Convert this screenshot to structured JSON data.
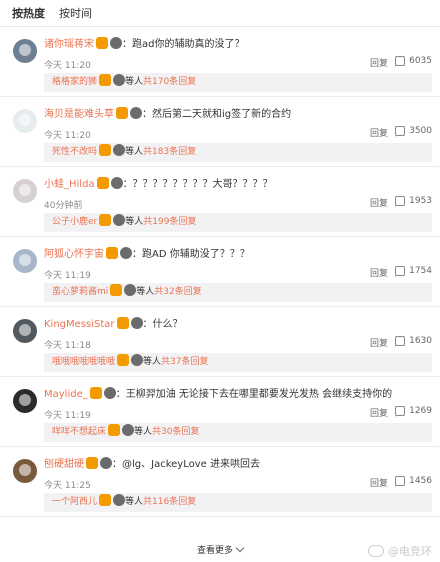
{
  "tabs": [
    {
      "label": "按热度"
    },
    {
      "label": "按时间"
    }
  ],
  "comments": [
    {
      "user": "诸你瑶蒋宋",
      "text": "：跑ad你的辅助真的没了？",
      "time": "今天 11:20",
      "reply": "回复",
      "likes": "6035",
      "sub_user": "格格家的狮",
      "sub_suffix": "等人",
      "sub_more": "共170条回复"
    },
    {
      "user": "海贝是能难头草",
      "text": "：然后第二天就和ig签了新的合约",
      "time": "今天 11:20",
      "reply": "回复",
      "likes": "3500",
      "sub_user": "死性不改吗",
      "sub_suffix": "等人",
      "sub_more": "共183条回复"
    },
    {
      "user": "小蛙_Hilda",
      "text": "：？？？？？？？？大哥？？？？",
      "time": "40分钟前",
      "reply": "回复",
      "likes": "1953",
      "sub_user": "公子小鹿er",
      "sub_suffix": "等人",
      "sub_more": "共199条回复"
    },
    {
      "user": "阿狐心怀宇宙",
      "text": "：跑AD 你辅助没了？？？",
      "time": "今天 11:19",
      "reply": "回复",
      "likes": "1754",
      "sub_user": "蛮心萝莉酱mi",
      "sub_suffix": "等人",
      "sub_more": "共32条回复"
    },
    {
      "user": "KingMessiStar",
      "text": "：什么？",
      "time": "今天 11:18",
      "reply": "回复",
      "likes": "1630",
      "sub_user": "哦哦哦哦哦哦哦",
      "sub_suffix": "等人",
      "sub_more": "共37条回复"
    },
    {
      "user": "Maylide_",
      "text": "：王柳羿加油 无论接下去在哪里都要发光发热 会继续支持你的",
      "time": "今天 11:19",
      "reply": "回复",
      "likes": "1269",
      "sub_user": "咩咩不想起床",
      "sub_suffix": "等人",
      "sub_more": "共30条回复"
    },
    {
      "user": "刨硬甜硬",
      "text": "：@lg、JackeyLove 进来哄回去",
      "time": "今天 11:25",
      "reply": "回复",
      "likes": "1456",
      "sub_user": "一个阿西儿",
      "sub_suffix": "等人",
      "sub_more": "共116条回复"
    }
  ],
  "footer": {
    "label": "查看更多"
  },
  "watermark": {
    "text": "@电竞环"
  },
  "icons": {
    "thumb": "thumbs-up-icon",
    "chevron": "chevron-down-icon"
  }
}
